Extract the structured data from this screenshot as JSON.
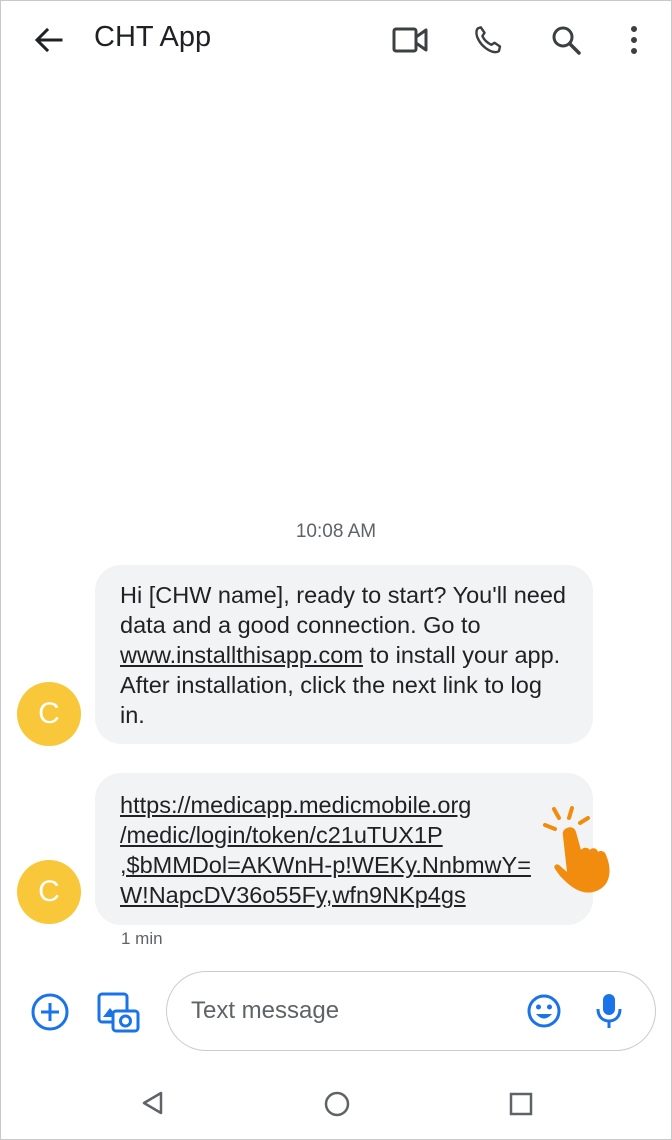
{
  "app_bar": {
    "title": "CHT App",
    "icons": [
      "back-arrow-icon",
      "video-call-icon",
      "phone-icon",
      "search-icon",
      "more-vert-icon"
    ]
  },
  "conversation": {
    "timestamp": "10:08 AM",
    "sender_initial": "C",
    "avatar_color": "#f8c73a",
    "messages": [
      {
        "before_link": "Hi [CHW name], ready to start? You'll need data and a good connection. Go to ",
        "link": "www.installthisapp.com",
        "after_link": " to install your app. After installation, click the next link to log in."
      },
      {
        "link_lines": [
          "https://medicapp.medicmobile.org",
          "/medic/login/token/c21uTUX1P",
          ",$bMMDol=AKWnH-p!WEKy.NnbmwY=",
          "W!NapcDV36o55Fy,wfn9NKp4gs"
        ],
        "time": "1 min"
      }
    ]
  },
  "compose": {
    "placeholder": "Text message",
    "icons": [
      "add-icon",
      "gallery-camera-icon",
      "emoji-icon",
      "mic-icon"
    ]
  },
  "colors": {
    "accent_blue": "#1a73e8",
    "bubble_gray": "#f1f3f4",
    "tap_hand_orange": "#f28c0f"
  },
  "nav_bar": {
    "icons": [
      "back-triangle-icon",
      "home-circle-icon",
      "recents-square-icon"
    ]
  }
}
